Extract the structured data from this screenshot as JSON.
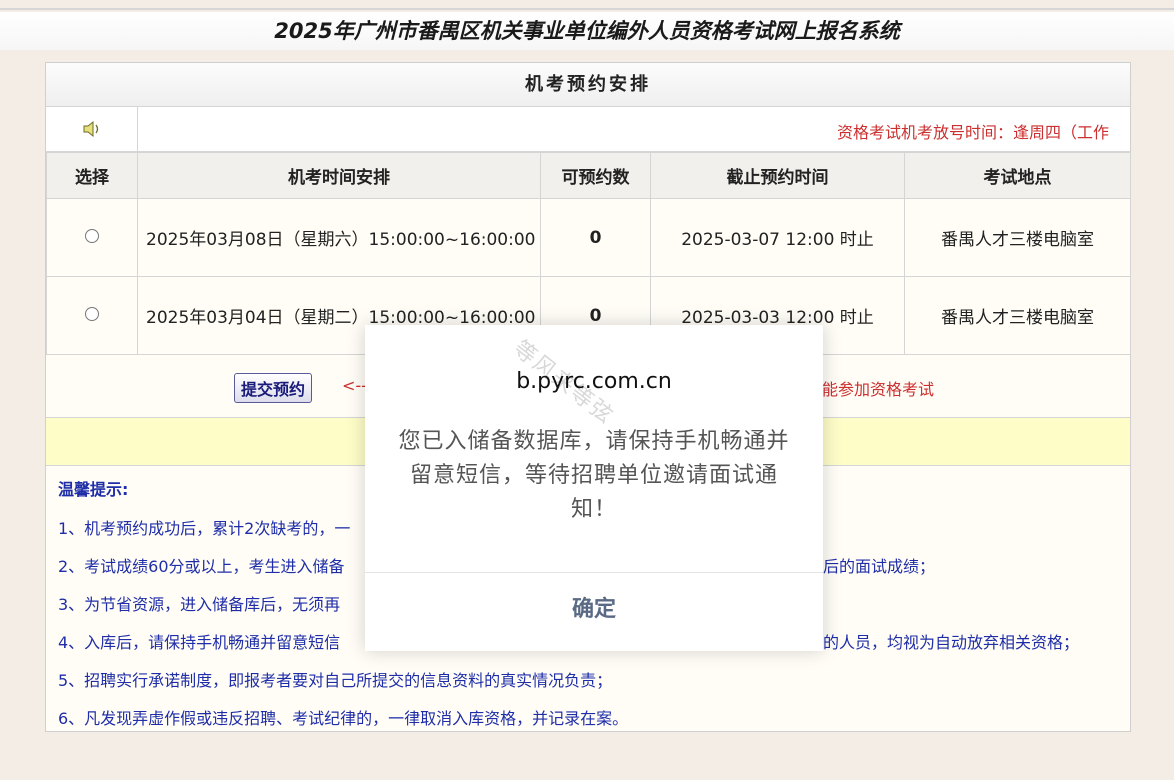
{
  "header": {
    "title": "2025年广州市番禺区机关事业单位编外人员资格考试网上报名系统"
  },
  "panel": {
    "title": "机考预约安排",
    "notice": "资格考试机考放号时间：逢周四（工作"
  },
  "table": {
    "headers": [
      "选择",
      "机考时间安排",
      "可预约数",
      "截止预约时间",
      "考试地点"
    ],
    "rows": [
      {
        "time": "2025年03月08日（星期六）15:00:00~16:00:00",
        "available": "0",
        "deadline": "2025-03-07 12:00 时止",
        "location": "番禺人才三楼电脑室"
      },
      {
        "time": "2025年03月04日（星期二）15:00:00~16:00:00",
        "available": "0",
        "deadline": "2025-03-03 12:00 时止",
        "location": "番禺人才三楼电脑室"
      }
    ]
  },
  "actions": {
    "submit_label": "提交预约",
    "arrow_hint": "<--",
    "warning": "能参加资格考试"
  },
  "tips": {
    "title": "温馨提示:",
    "items": [
      "1、机考预约成功后，累计2次缺考的，一",
      "2、考试成绩60分或以上，考生进入储备",
      "3、为节省资源，进入储备库后，无须再",
      "4、入库后，请保持手机畅通并留意短信",
      "5、招聘实行承诺制度，即报考者要对自己所提交的信息资料的真实情况负责；",
      "6、凡发现弄虚作假或违反招聘、考试纪律的，一律取消入库资格，并记录在案。"
    ],
    "tail_items": {
      "line2": "后的面试成绩；",
      "line4": "的人员，均视为自动放弃相关资格；"
    }
  },
  "modal": {
    "domain": "b.pyrc.com.cn",
    "message": "您已入储备数据库，请保持手机畅通并留意短信，等待招聘单位邀请面试通知！",
    "ok_label": "确定",
    "watermark": "等风来等弦"
  },
  "colors": {
    "accent_red": "#cc2f2f",
    "tips_blue": "#1f2ea8",
    "yellow_bar": "#fefdc8"
  }
}
